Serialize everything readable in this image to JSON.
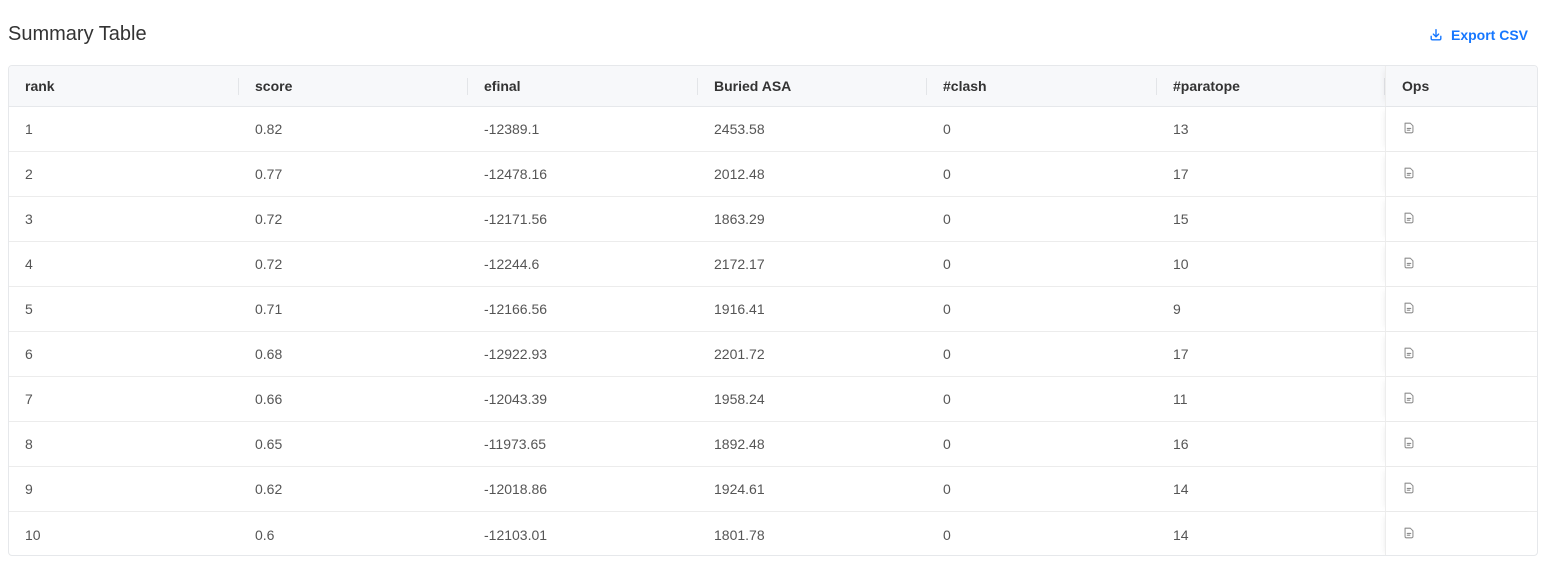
{
  "header": {
    "title": "Summary Table",
    "export_label": "Export CSV"
  },
  "table": {
    "columns": [
      "rank",
      "score",
      "efinal",
      "Buried ASA",
      "#clash",
      "#paratope",
      "Ops"
    ],
    "rows": [
      [
        "1",
        "0.82",
        "-12389.1",
        "2453.58",
        "0",
        "13"
      ],
      [
        "2",
        "0.77",
        "-12478.16",
        "2012.48",
        "0",
        "17"
      ],
      [
        "3",
        "0.72",
        "-12171.56",
        "1863.29",
        "0",
        "15"
      ],
      [
        "4",
        "0.72",
        "-12244.6",
        "2172.17",
        "0",
        "10"
      ],
      [
        "5",
        "0.71",
        "-12166.56",
        "1916.41",
        "0",
        "9"
      ],
      [
        "6",
        "0.68",
        "-12922.93",
        "2201.72",
        "0",
        "17"
      ],
      [
        "7",
        "0.66",
        "-12043.39",
        "1958.24",
        "0",
        "11"
      ],
      [
        "8",
        "0.65",
        "-11973.65",
        "1892.48",
        "0",
        "16"
      ],
      [
        "9",
        "0.62",
        "-12018.86",
        "1924.61",
        "0",
        "14"
      ],
      [
        "10",
        "0.6",
        "-12103.01",
        "1801.78",
        "0",
        "14"
      ]
    ],
    "row_op_icon": "document-detail-icon"
  },
  "colors": {
    "accent": "#1677ff",
    "header_bg": "#f7f8fa",
    "border": "#e6e8eb",
    "icon_gray": "#8c8c8c"
  }
}
